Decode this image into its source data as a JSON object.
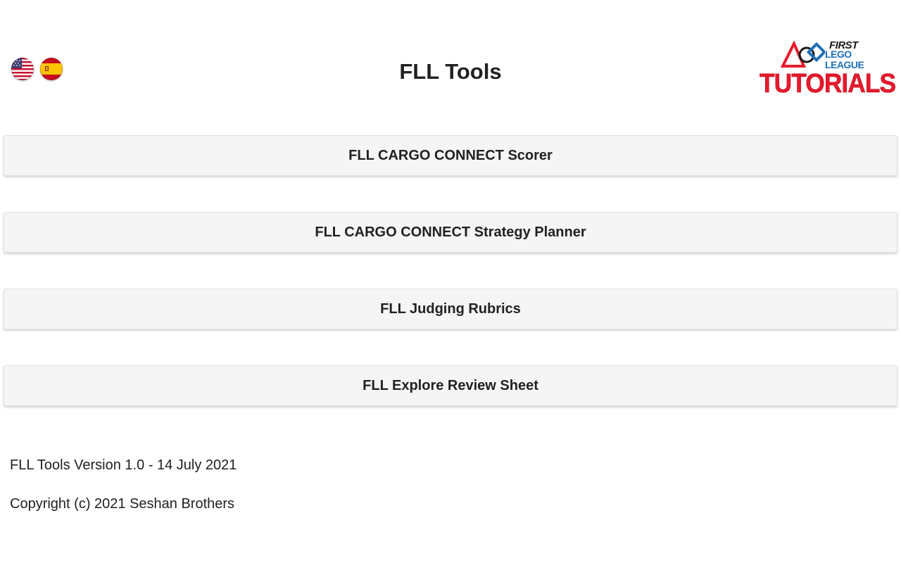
{
  "header": {
    "title": "FLL Tools",
    "flags": [
      {
        "name": "us-flag-icon",
        "language": "English"
      },
      {
        "name": "spain-flag-icon",
        "language": "Español"
      }
    ],
    "logo": {
      "first": "FIRST",
      "lego": "LEGO",
      "league": "LEAGUE",
      "tutorials": "TUTORIALS"
    }
  },
  "menu": {
    "items": [
      {
        "label": "FLL CARGO CONNECT Scorer"
      },
      {
        "label": "FLL CARGO CONNECT Strategy Planner"
      },
      {
        "label": "FLL Judging Rubrics"
      },
      {
        "label": "FLL Explore Review Sheet"
      }
    ]
  },
  "footer": {
    "version": "FLL Tools Version 1.0 - 14 July 2021",
    "copyright": "Copyright (c) 2021 Seshan Brothers"
  },
  "colors": {
    "logo_red": "#e8192c",
    "logo_blue": "#1f6fb8",
    "button_bg": "#f5f5f5"
  }
}
